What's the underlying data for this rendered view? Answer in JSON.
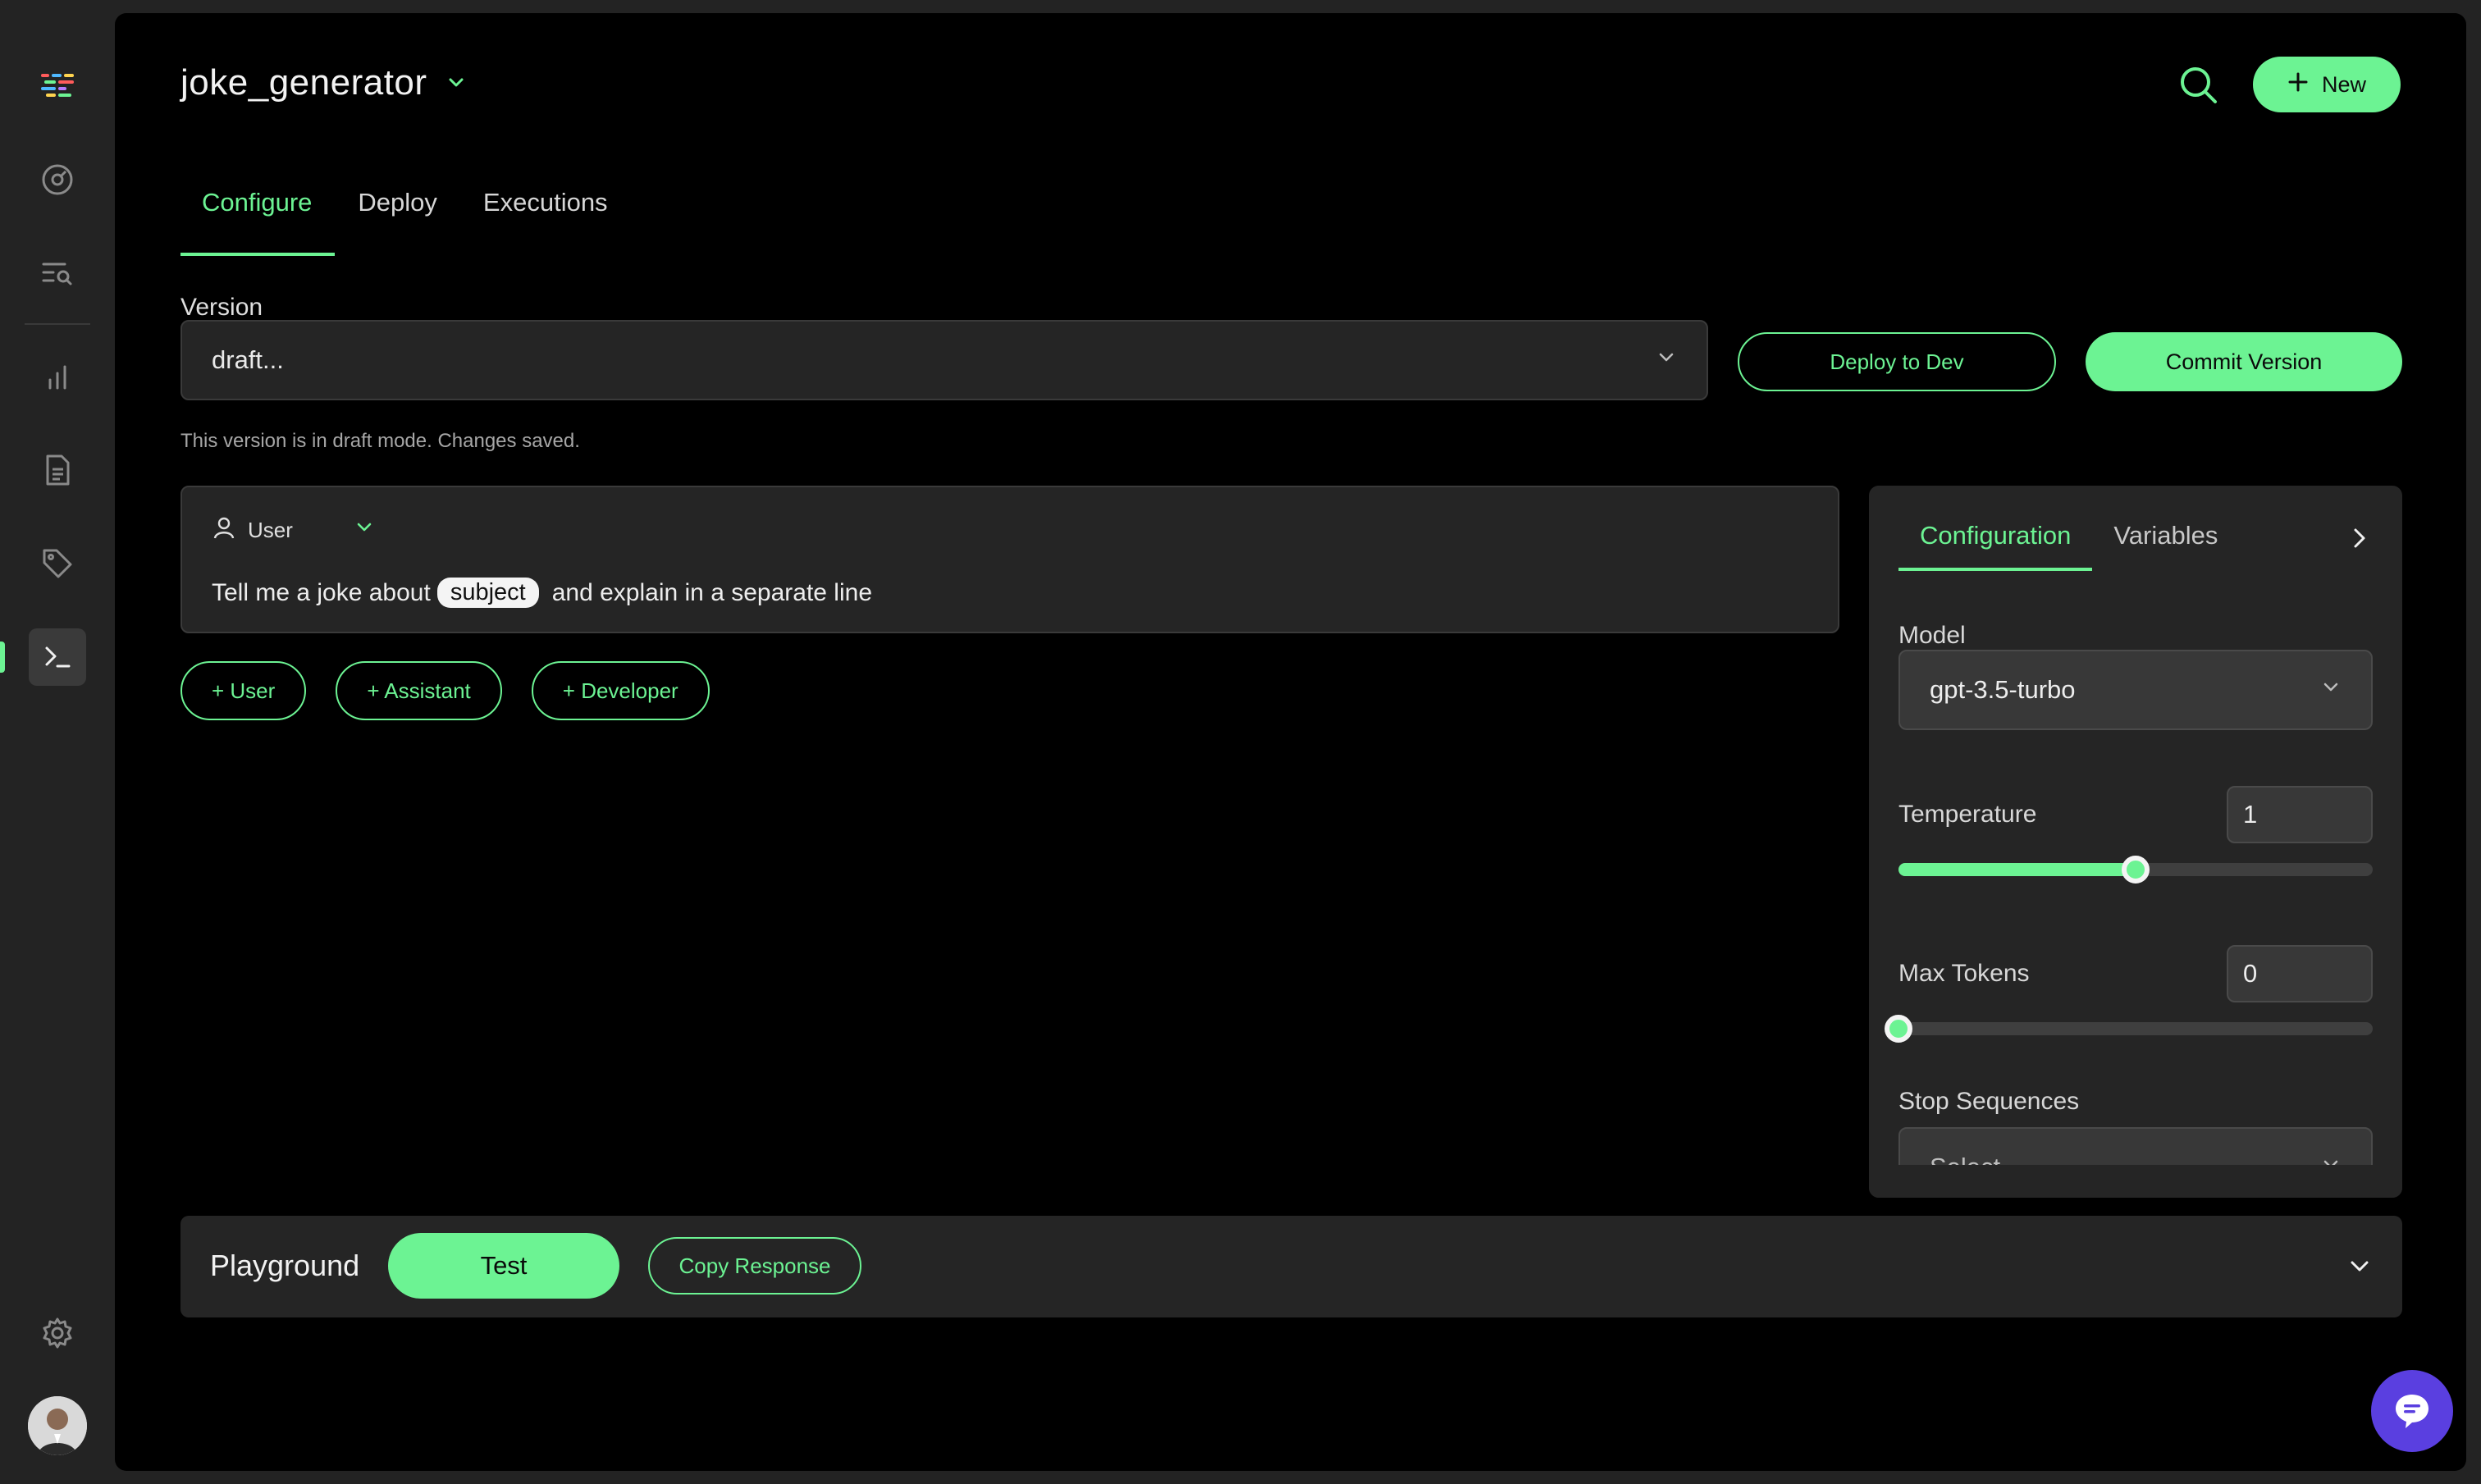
{
  "header": {
    "title": "joke_generator",
    "new_label": "New"
  },
  "tabs": [
    {
      "label": "Configure",
      "active": true
    },
    {
      "label": "Deploy",
      "active": false
    },
    {
      "label": "Executions",
      "active": false
    }
  ],
  "version": {
    "label": "Version",
    "value": "draft...",
    "note": "This version is in draft mode. Changes saved.",
    "deploy_label": "Deploy to Dev",
    "commit_label": "Commit Version"
  },
  "message": {
    "role": "User",
    "text_before": "Tell me a joke about",
    "variable": "subject",
    "text_after": "and explain in a separate line"
  },
  "add_buttons": {
    "user": "+ User",
    "assistant": "+ Assistant",
    "developer": "+ Developer"
  },
  "config_panel": {
    "tabs": [
      {
        "label": "Configuration",
        "active": true
      },
      {
        "label": "Variables",
        "active": false
      }
    ],
    "model_label": "Model",
    "model_value": "gpt-3.5-turbo",
    "temperature_label": "Temperature",
    "temperature_value": "1",
    "temperature_fraction": 0.5,
    "max_tokens_label": "Max Tokens",
    "max_tokens_value": "0",
    "max_tokens_fraction": 0.0,
    "stop_sequences_label": "Stop Sequences",
    "stop_sequences_value": "Select..."
  },
  "playground": {
    "title": "Playground",
    "test_label": "Test",
    "copy_label": "Copy Response"
  },
  "colors": {
    "accent": "#6cf393",
    "background": "#000000",
    "surface": "#252525",
    "chat_bubble": "#5a3fe0"
  },
  "icons": {
    "sidebar": [
      "logo-icon",
      "dashboard-gauge-icon",
      "search-list-icon",
      "bar-chart-icon",
      "document-icon",
      "tag-icon",
      "terminal-icon",
      "settings-gear-icon"
    ]
  }
}
